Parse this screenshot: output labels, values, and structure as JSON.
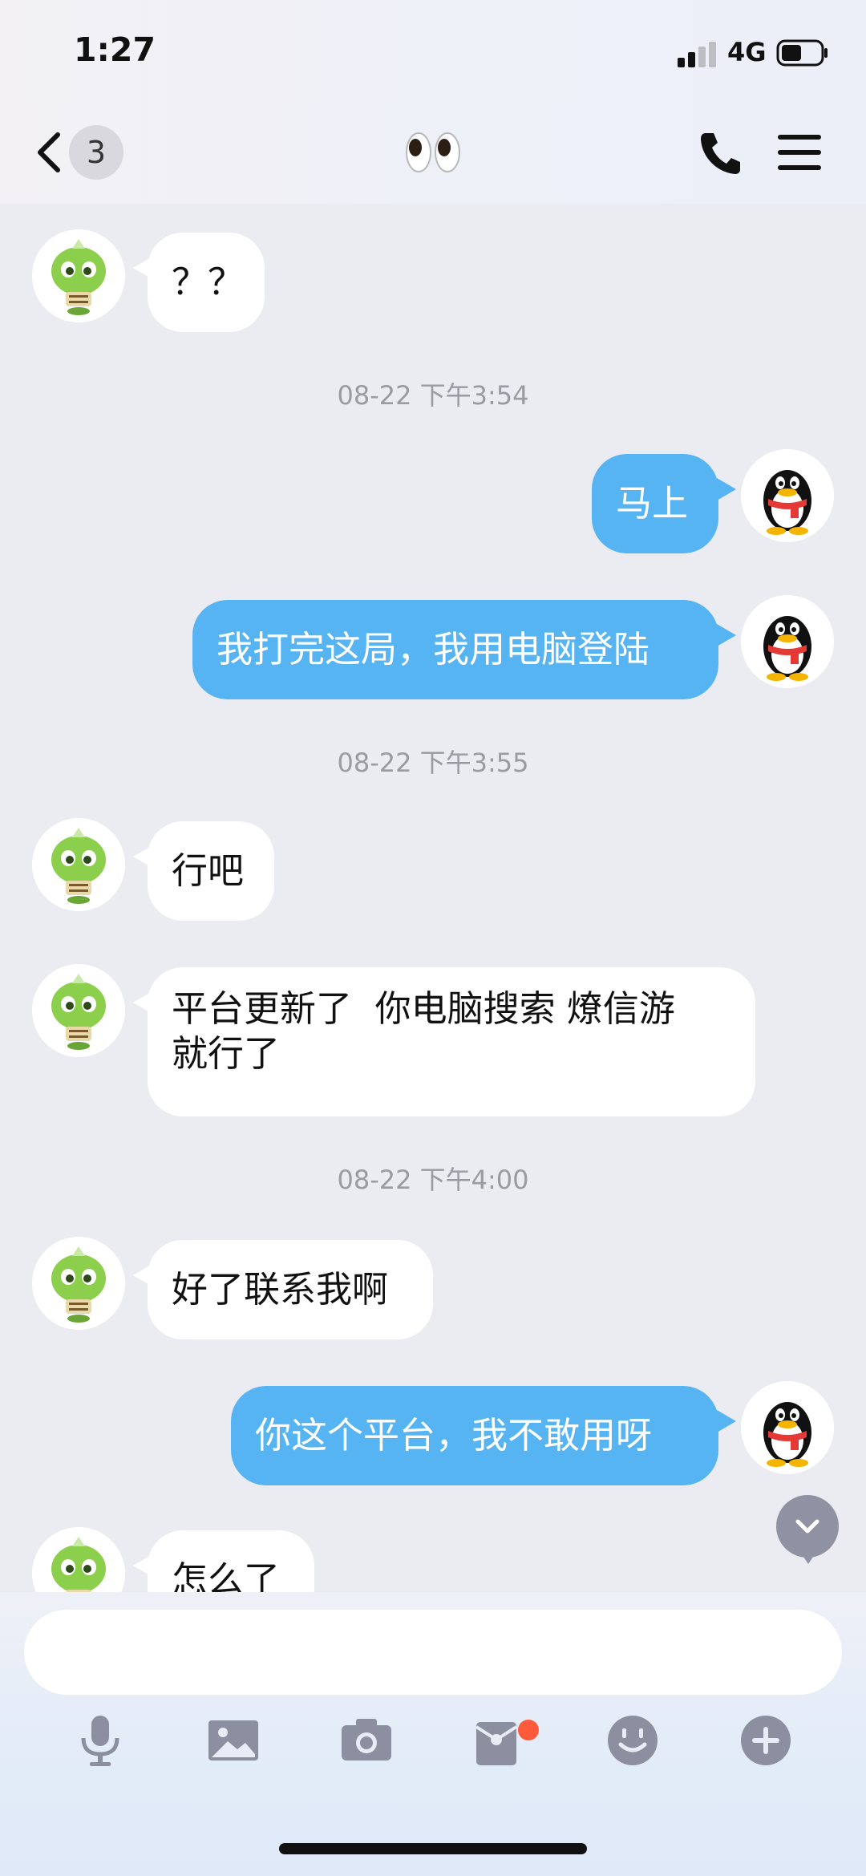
{
  "status_bar": {
    "time": "1:27",
    "network": "4G"
  },
  "header": {
    "unread_count": "3",
    "title_icon": "eyes-emoji"
  },
  "icons": {
    "back": "chevron-left-icon",
    "call": "phone-icon",
    "menu": "hamburger-menu-icon",
    "voice": "microphone-icon",
    "image": "image-icon",
    "camera": "camera-icon",
    "redpacket": "red-packet-icon",
    "emoji": "smile-icon",
    "plus": "plus-icon"
  },
  "colors": {
    "outgoing_bubble": "#56b4f3",
    "incoming_bubble": "#ffffff",
    "background": "#ebebf2"
  },
  "chat": {
    "m1": "？？",
    "ts1": "08-22 下午3:54",
    "m2": "马上",
    "m3": "我打完这局，我用电脑登陆",
    "ts2": "08-22 下午3:55",
    "m4": "行吧",
    "m5": "平台更新了  你电脑搜索 燎信游\n就行了",
    "ts3": "08-22 下午4:00",
    "m6": "好了联系我啊",
    "m7": "你这个平台，我不敢用呀",
    "m8": "怎么了"
  },
  "input": {
    "value": "",
    "placeholder": ""
  }
}
